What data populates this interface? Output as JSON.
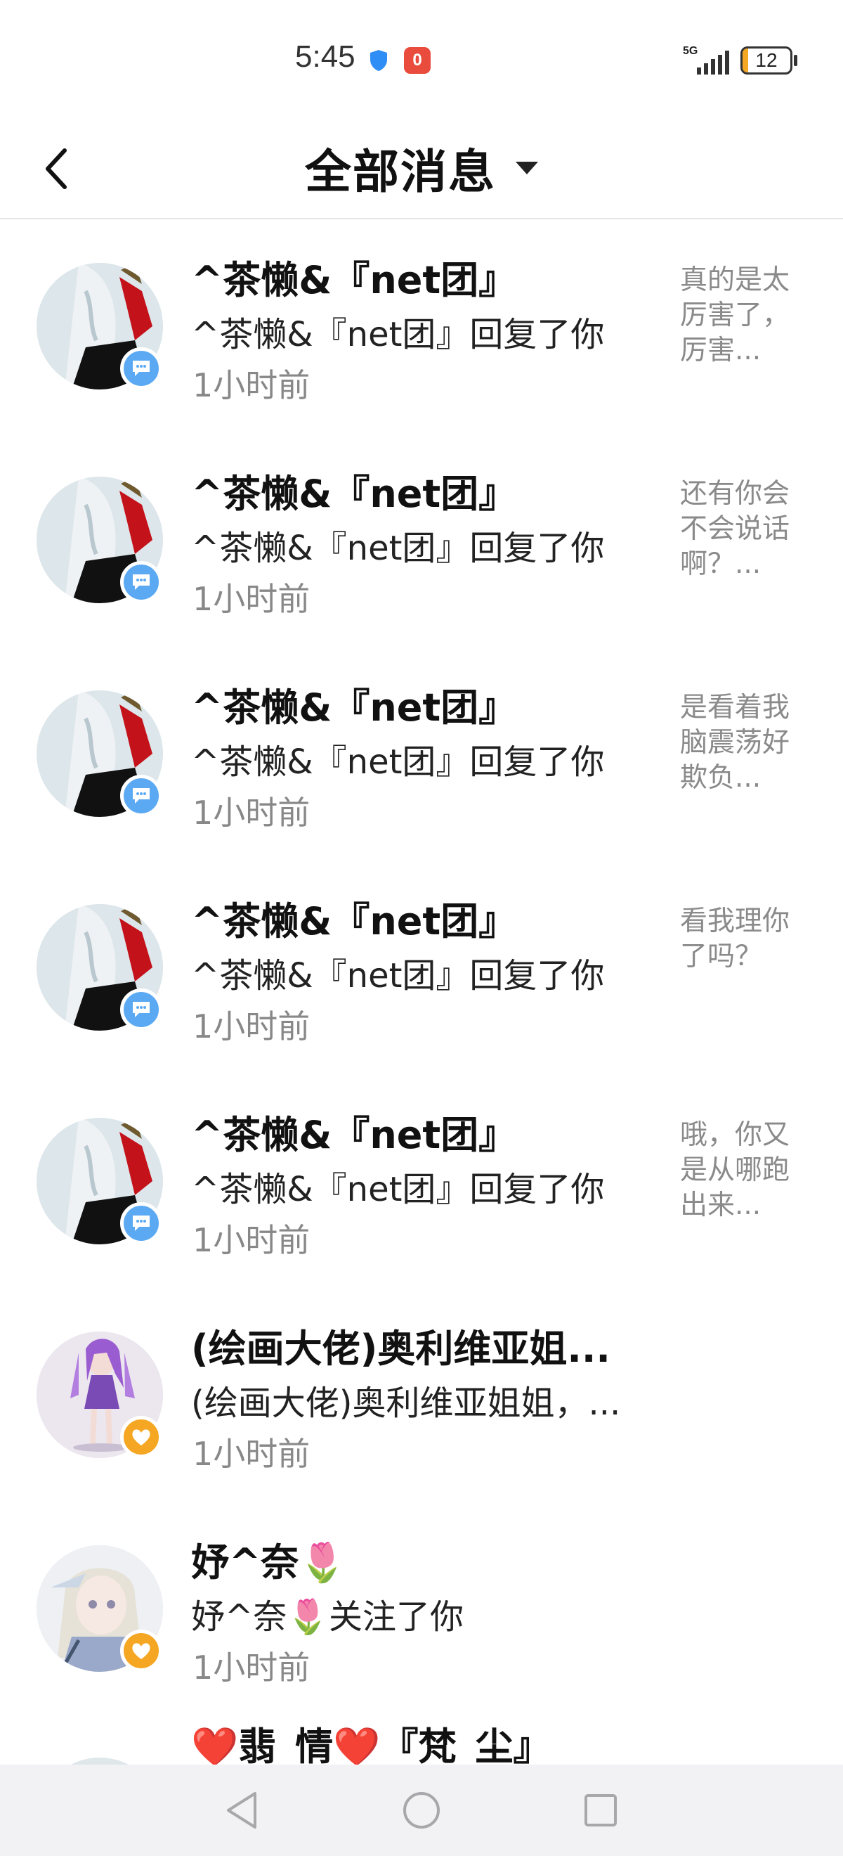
{
  "status_bar": {
    "time": "5:45",
    "notification_count": "0",
    "network": "5G",
    "battery": "12",
    "battery_level_percent": 12,
    "icons": [
      "shield-icon",
      "signal-icon",
      "battery-icon"
    ]
  },
  "header": {
    "title": "全部消息",
    "back_icon": "chevron-left-icon",
    "dropdown_icon": "caret-down-icon"
  },
  "messages": [
    {
      "name": "^茶懒&『net团』",
      "description": "^茶懒&『net团』回复了你",
      "time": "1小时前",
      "preview": "真的是太厉害了，厉害...",
      "badge": "comment",
      "avatar": "anime-avatar-white-red"
    },
    {
      "name": "^茶懒&『net团』",
      "description": "^茶懒&『net团』回复了你",
      "time": "1小时前",
      "preview": "还有你会不会说话啊？...",
      "badge": "comment",
      "avatar": "anime-avatar-white-red"
    },
    {
      "name": "^茶懒&『net团』",
      "description": "^茶懒&『net团』回复了你",
      "time": "1小时前",
      "preview": "是看着我脑震荡好欺负...",
      "badge": "comment",
      "avatar": "anime-avatar-white-red"
    },
    {
      "name": "^茶懒&『net团』",
      "description": "^茶懒&『net团』回复了你",
      "time": "1小时前",
      "preview": "看我理你了吗？",
      "badge": "comment",
      "avatar": "anime-avatar-white-red"
    },
    {
      "name": "^茶懒&『net团』",
      "description": "^茶懒&『net团』回复了你",
      "time": "1小时前",
      "preview": "哦，你又是从哪跑出来...",
      "badge": "comment",
      "avatar": "anime-avatar-white-red"
    },
    {
      "name": "(绘画大佬)奥利维亚姐...",
      "description": "(绘画大佬)奥利维亚姐姐，...",
      "time": "1小时前",
      "preview": "",
      "badge": "like",
      "avatar": "anime-avatar-purple-twintails"
    },
    {
      "name": "妤^奈🌷",
      "description": "妤^奈🌷关注了你",
      "time": "1小时前",
      "preview": "",
      "badge": "like",
      "avatar": "anime-avatar-silver-hair"
    }
  ],
  "partial_item": {
    "name": "❤️翡_情❤️『梵_尘』"
  },
  "nav_bar": {
    "icons": [
      "back-triangle-icon",
      "home-circle-icon",
      "recents-square-icon"
    ]
  },
  "colors": {
    "comment_badge": "#5ba9f2",
    "like_badge": "#f5a623",
    "battery_fill": "#f5a623",
    "notification_badge": "#e94b3c",
    "shield": "#2f8ef5"
  }
}
